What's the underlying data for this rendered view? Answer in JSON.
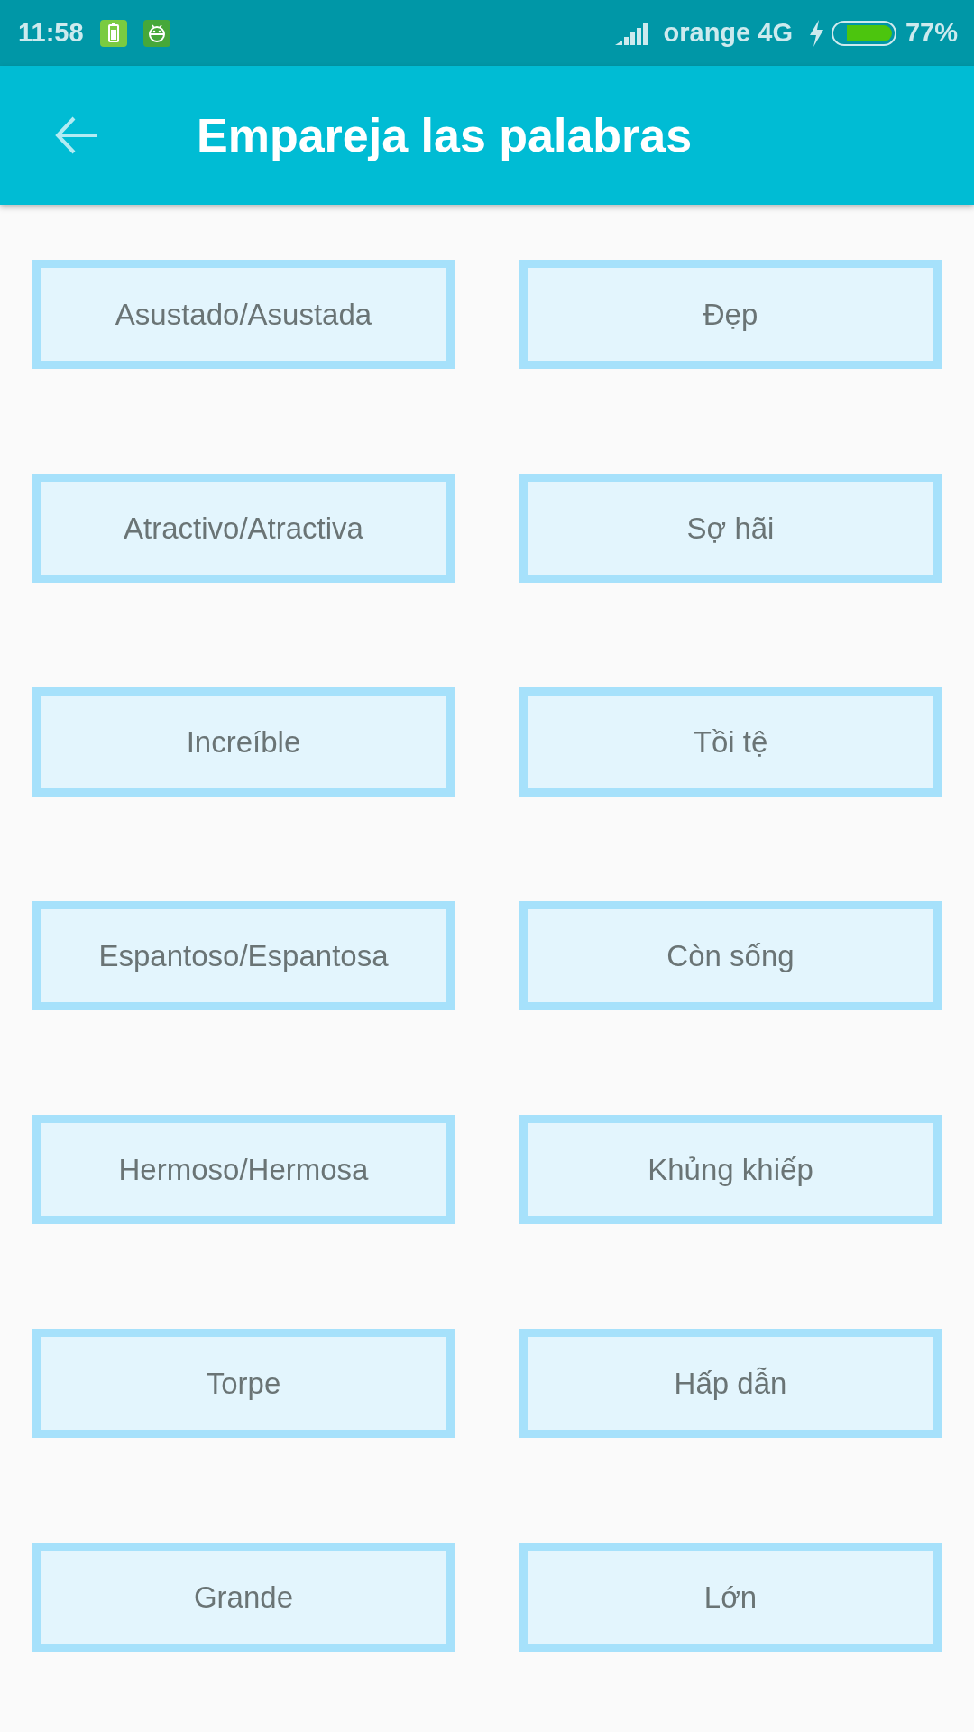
{
  "status_bar": {
    "time": "11:58",
    "carrier": "orange 4G",
    "battery_percent": "77%"
  },
  "app_bar": {
    "title": "Empareja las palabras"
  },
  "rows": [
    {
      "left_word": "Asustado/Asustada",
      "right_word": "Đẹp"
    },
    {
      "left_word": "Atractivo/Atractiva",
      "right_word": "Sợ hãi"
    },
    {
      "left_word": "Increíble",
      "right_word": "Tồi tệ"
    },
    {
      "left_word": "Espantoso/Espantosa",
      "right_word": "Còn sống"
    },
    {
      "left_word": "Hermoso/Hermosa",
      "right_word": "Khủng khiếp"
    },
    {
      "left_word": "Torpe",
      "right_word": "Hấp dẫn"
    },
    {
      "left_word": "Grande",
      "right_word": "Lớn"
    }
  ]
}
